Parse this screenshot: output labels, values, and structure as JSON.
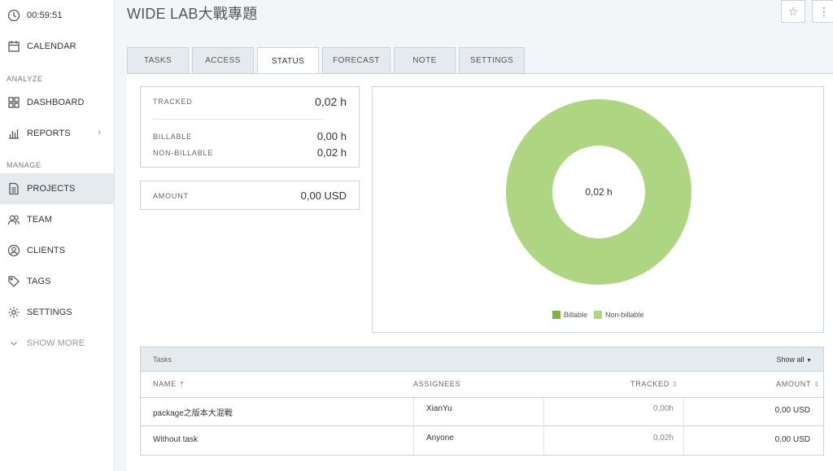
{
  "sidebar": {
    "timer": "00:59:51",
    "calendar": "CALENDAR",
    "section_analyze": "ANALYZE",
    "dashboard": "DASHBOARD",
    "reports": "REPORTS",
    "section_manage": "MANAGE",
    "projects": "PROJECTS",
    "team": "TEAM",
    "clients": "CLIENTS",
    "tags": "TAGS",
    "settings": "SETTINGS",
    "show_more": "SHOW MORE"
  },
  "header": {
    "title": "WIDE LAB大戰專題"
  },
  "tabs": [
    "TASKS",
    "ACCESS",
    "STATUS",
    "FORECAST",
    "NOTE",
    "SETTINGS"
  ],
  "summary": {
    "tracked_label": "TRACKED",
    "tracked_value": "0,02 h",
    "billable_label": "BILLABLE",
    "billable_value": "0,00 h",
    "nonbillable_label": "NON-BILLABLE",
    "nonbillable_value": "0,02 h",
    "amount_label": "AMOUNT",
    "amount_value": "0,00 USD"
  },
  "chart_data": {
    "type": "pie",
    "categories": [
      "Billable",
      "Non-billable"
    ],
    "values": [
      0.0,
      0.02
    ],
    "center_label": "0,02 h",
    "colors": [
      "#7cb342",
      "#aed581"
    ],
    "legend_position": "bottom"
  },
  "tasks": {
    "title": "Tasks",
    "show_all": "Show all",
    "columns": {
      "name": "NAME",
      "assignees": "ASSIGNEES",
      "tracked": "TRACKED",
      "amount": "AMOUNT"
    },
    "rows": [
      {
        "name": "package之版本大混戰",
        "assignees": "XianYu",
        "tracked": "0,00h",
        "amount": "0,00 USD"
      },
      {
        "name": "Without task",
        "assignees": "Anyone",
        "tracked": "0,02h",
        "amount": "0,00 USD"
      }
    ]
  }
}
